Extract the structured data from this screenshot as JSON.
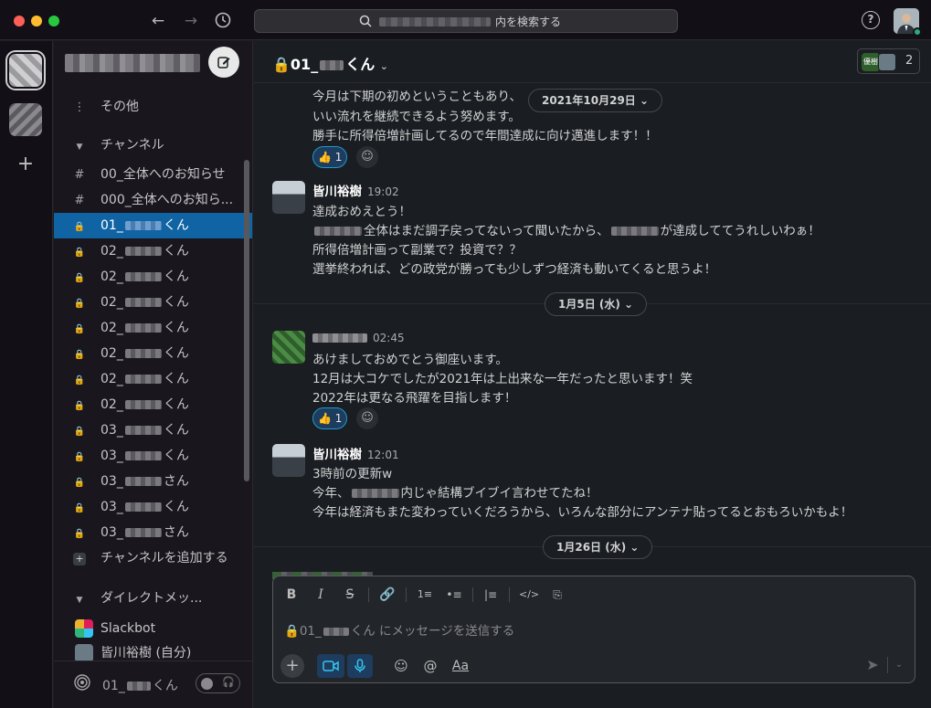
{
  "search": {
    "text": "内を検索する"
  },
  "sidebar": {
    "more": "その他",
    "channels_header": "チャンネル",
    "channels": [
      {
        "prefix": "00_全体へのお知らせ",
        "suffix": "",
        "lock": false,
        "active": false
      },
      {
        "prefix": "000_全体へのお知ら...",
        "suffix": "",
        "lock": false,
        "active": false
      },
      {
        "prefix": "01_",
        "suffix": "くん",
        "lock": true,
        "active": true
      },
      {
        "prefix": "02_",
        "suffix": "くん",
        "lock": true,
        "active": false
      },
      {
        "prefix": "02_",
        "suffix": "くん",
        "lock": true,
        "active": false
      },
      {
        "prefix": "02_",
        "suffix": "くん",
        "lock": true,
        "active": false
      },
      {
        "prefix": "02_",
        "suffix": "くん",
        "lock": true,
        "active": false
      },
      {
        "prefix": "02_",
        "suffix": "くん",
        "lock": true,
        "active": false
      },
      {
        "prefix": "02_",
        "suffix": "くん",
        "lock": true,
        "active": false
      },
      {
        "prefix": "02_",
        "suffix": "くん",
        "lock": true,
        "active": false
      },
      {
        "prefix": "03_",
        "suffix": "くん",
        "lock": true,
        "active": false
      },
      {
        "prefix": "03_",
        "suffix": "くん",
        "lock": true,
        "active": false
      },
      {
        "prefix": "03_",
        "suffix": "さん",
        "lock": true,
        "active": false
      },
      {
        "prefix": "03_",
        "suffix": "くん",
        "lock": true,
        "active": false
      },
      {
        "prefix": "03_",
        "suffix": "さん",
        "lock": true,
        "active": false
      }
    ],
    "add_channel": "チャンネルを追加する",
    "dm_header": "ダイレクトメッ...",
    "dms": [
      {
        "name": "Slackbot",
        "avatar": "slackbot"
      },
      {
        "name": "皆川裕樹 (自分)",
        "avatar": "me"
      }
    ],
    "huddle_prefix": "01_",
    "huddle_suffix": "くん"
  },
  "channel": {
    "prefix": "01_",
    "suffix": "くん",
    "member_badge": "優樹",
    "member_count": "2"
  },
  "messages": {
    "m0": {
      "lines": [
        "今月は下期の初めということもあり、",
        "いい流れを継続できるよう努めます。",
        "勝手に所得倍増計画してるので年間達成に向け邁進します！！"
      ],
      "reaction": {
        "emoji": "👍",
        "count": "1"
      }
    },
    "date1": "2021年10月29日",
    "m1": {
      "author": "皆川裕樹",
      "time": "19:02",
      "l1": "達成おめえとう！",
      "l2a": "全体はまだ調子戻ってないって聞いたから、",
      "l2b": "が達成しててうれしいわぁ！",
      "l3": "所得倍増計画って副業で？投資で？？",
      "l4": "選挙終われば、どの政党が勝っても少しずつ経済も動いてくると思うよ！"
    },
    "date2": "1月5日 (水)",
    "m2": {
      "time": "02:45",
      "lines": [
        "あけましておめでとう御座います。",
        "12月は大コケでしたが2021年は上出来な一年だったと思います！笑",
        "2022年は更なる飛躍を目指します！"
      ],
      "reaction": {
        "emoji": "👍",
        "count": "1"
      }
    },
    "m3": {
      "author": "皆川裕樹",
      "time": "12:01",
      "l1": "3時前の更新w",
      "l2a": "今年、",
      "l2b": "内じゃ結構ブイブイ言わせてたね！",
      "l3": "今年は経済もまた変わっていくだろうから、いろんな部分にアンテナ貼ってるとおもろいかもよ！"
    },
    "date3": "1月26日 (水)"
  },
  "composer": {
    "placeholder_prefix": "01_",
    "placeholder_suffix": "くん にメッセージを送信する",
    "aa": "Aa"
  },
  "colors": {
    "accent": "#1164a3",
    "background": "#1a1d21",
    "sidebar": "#19171d",
    "online": "#2bac76"
  }
}
